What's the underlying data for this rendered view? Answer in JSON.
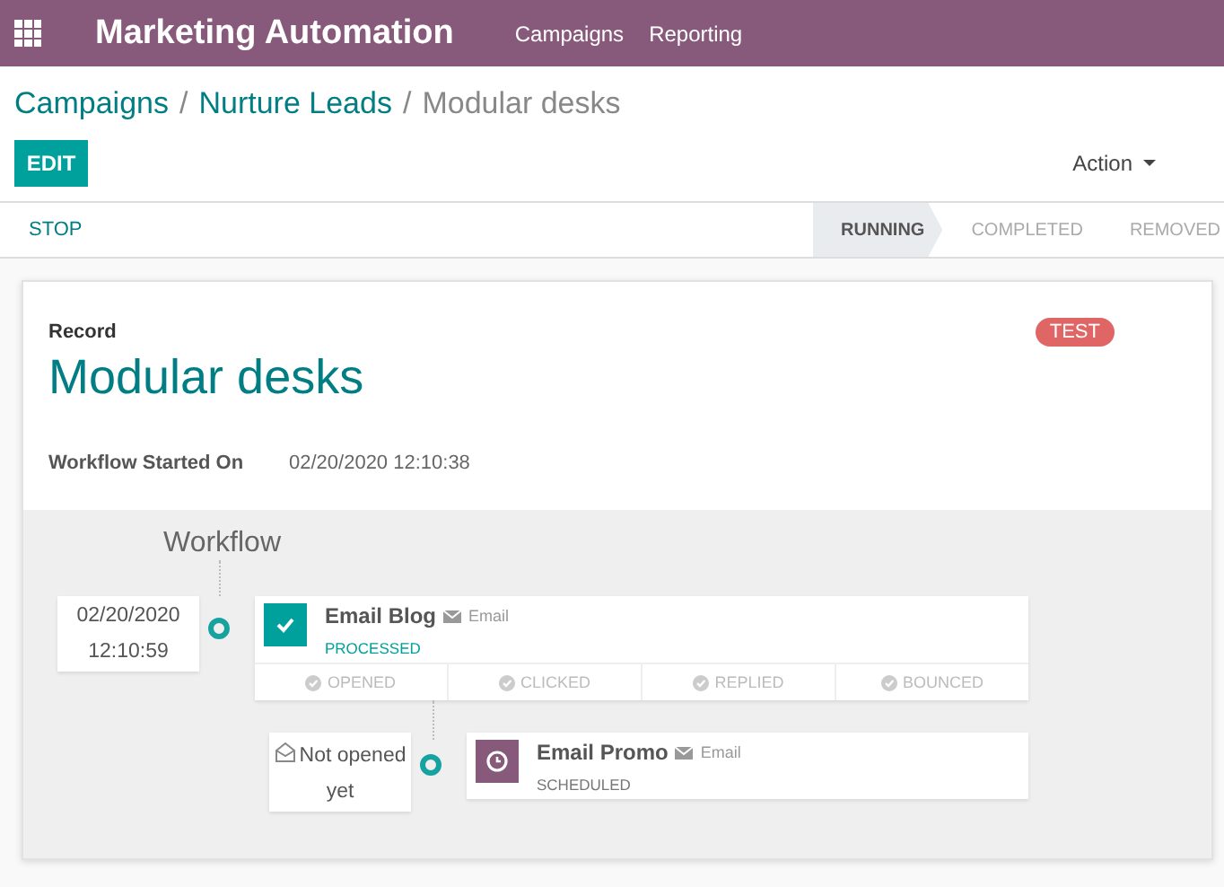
{
  "navbar": {
    "app_title": "Marketing Automation",
    "menu": [
      {
        "label": "Campaigns"
      },
      {
        "label": "Reporting"
      }
    ]
  },
  "breadcrumbs": [
    {
      "kind": "link",
      "label": "Campaigns"
    },
    {
      "kind": "separator",
      "label": "/"
    },
    {
      "kind": "link",
      "label": "Nurture Leads"
    },
    {
      "kind": "separator",
      "label": "/"
    },
    {
      "kind": "current",
      "label": "Modular desks"
    }
  ],
  "edit_button": "EDIT",
  "action_menu": "Action",
  "status_bar": {
    "button": "STOP",
    "stages": [
      {
        "label": "RUNNING",
        "selected": true
      },
      {
        "label": "COMPLETED",
        "selected": false
      },
      {
        "label": "REMOVED",
        "selected": false
      }
    ]
  },
  "record": {
    "label": "Record",
    "name": "Modular desks",
    "tag": "TEST",
    "fields": [
      {
        "label": "Workflow Started On",
        "value": "02/20/2020 12:10:38"
      }
    ]
  },
  "workflow": {
    "title": "Workflow",
    "activities": [
      {
        "kind": "processed",
        "when": "02/20/2020 12:10:59",
        "name": "Email Blog",
        "type": "Email",
        "status": "PROCESSED",
        "stats": [
          {
            "label": "OPENED"
          },
          {
            "label": "CLICKED"
          },
          {
            "label": "REPLIED"
          },
          {
            "label": "BOUNCED"
          }
        ],
        "children": [
          {
            "kind": "scheduled",
            "trigger": "Not opened yet",
            "name": "Email Promo",
            "type": "Email",
            "status": "SCHEDULED"
          }
        ]
      }
    ]
  }
}
